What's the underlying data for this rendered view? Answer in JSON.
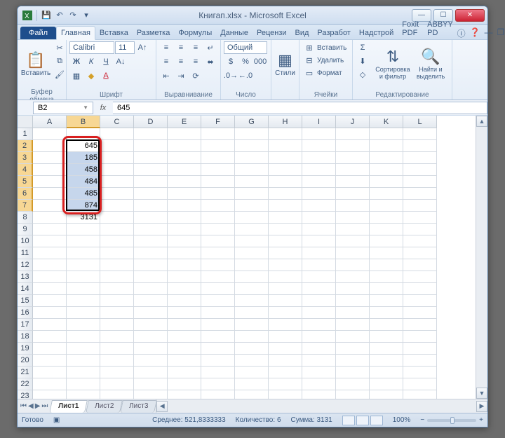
{
  "window": {
    "title": "Книгап.xlsx - Microsoft Excel"
  },
  "qat": {
    "save": "💾",
    "undo": "↶",
    "redo": "↷"
  },
  "ribbon": {
    "file": "Файл",
    "tabs": [
      "Главная",
      "Вставка",
      "Разметка",
      "Формулы",
      "Данные",
      "Рецензи",
      "Вид",
      "Разработ",
      "Надстрой",
      "Foxit PDF",
      "ABBYY PD"
    ],
    "help_icons": [
      "❷",
      "ⓘ"
    ],
    "groups": {
      "clipboard": {
        "paste": "Вставить",
        "label": "Буфер обмена"
      },
      "font": {
        "name": "Calibri",
        "size": "11",
        "label": "Шрифт"
      },
      "align": {
        "label": "Выравнивание"
      },
      "number": {
        "format": "Общий",
        "label": "Число"
      },
      "styles": {
        "btn": "Стили",
        "label": ""
      },
      "cells": {
        "insert": "Вставить",
        "delete": "Удалить",
        "format": "Формат",
        "label": "Ячейки"
      },
      "editing": {
        "sort": "Сортировка и фильтр",
        "find": "Найти и выделить",
        "label": "Редактирование"
      }
    }
  },
  "namebox": "B2",
  "formula": "645",
  "columns": [
    "A",
    "B",
    "C",
    "D",
    "E",
    "F",
    "G",
    "H",
    "I",
    "J",
    "K",
    "L"
  ],
  "rows": 23,
  "selected_col": "B",
  "selected_rows_start": 2,
  "selected_rows_end": 7,
  "cells": {
    "B2": "645",
    "B3": "185",
    "B4": "458",
    "B5": "484",
    "B6": "485",
    "B7": "874",
    "B8": "3131"
  },
  "sheets": {
    "nav": [
      "⏮",
      "◀",
      "▶",
      "⏭"
    ],
    "tabs": [
      "Лист1",
      "Лист2",
      "Лист3"
    ],
    "active": 0
  },
  "status": {
    "ready": "Готово",
    "avg_label": "Среднее:",
    "avg": "521,8333333",
    "count_label": "Количество:",
    "count": "6",
    "sum_label": "Сумма:",
    "sum": "3131",
    "zoom": "100%"
  }
}
